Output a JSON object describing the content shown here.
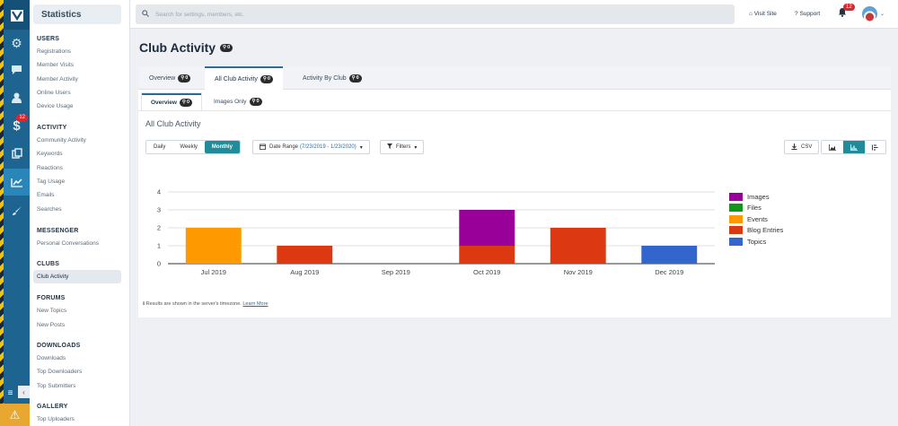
{
  "rail": {
    "notification_badge": "12",
    "icons": [
      "dashboard-icon",
      "chat-icon",
      "user-icon",
      "dollar-icon",
      "clipboard-icon",
      "stats-icon",
      "brush-icon"
    ]
  },
  "sidebar": {
    "title": "Statistics",
    "sections": [
      {
        "heading": "USERS",
        "items": [
          "Registrations",
          "Member Visits",
          "Member Activity",
          "Online Users",
          "Device Usage"
        ]
      },
      {
        "heading": "ACTIVITY",
        "items": [
          "Community Activity",
          "Keywords",
          "Reactions",
          "Tag Usage",
          "Emails",
          "Searches"
        ]
      },
      {
        "heading": "MESSENGER",
        "items": [
          "Personal Conversations"
        ]
      },
      {
        "heading": "CLUBS",
        "items": [
          "Club Activity"
        ]
      },
      {
        "heading": "FORUMS",
        "items": [
          "New Topics",
          "New Posts"
        ]
      },
      {
        "heading": "DOWNLOADS",
        "items": [
          "Downloads",
          "Top Downloaders",
          "Top Submitters"
        ]
      },
      {
        "heading": "GALLERY",
        "items": [
          "Top Uploaders"
        ]
      }
    ]
  },
  "topbar": {
    "search_placeholder": "Search for settings, members, etc.",
    "visit_site": "Visit Site",
    "support": "Support",
    "bell_badge": "12"
  },
  "page": {
    "title": "Club Activity",
    "title_badge": "0",
    "tabs": [
      {
        "label": "Overview",
        "badge": "0"
      },
      {
        "label": "All Club Activity",
        "badge": "0"
      },
      {
        "label": "Activity By Club",
        "badge": "0"
      }
    ],
    "subtabs": [
      {
        "label": "Overview",
        "badge": "0"
      },
      {
        "label": "Images Only",
        "badge": "0"
      }
    ],
    "chart_heading": "All Club Activity",
    "periods": [
      "Daily",
      "Weekly",
      "Monthly"
    ],
    "date_range_label": "Date Range",
    "date_range_value": "(7/23/2019 - 1/23/2020)",
    "filters_label": "Filters",
    "csv_label": "CSV",
    "footnote": "Results are shown in the server's timezone.",
    "learn_more": "Learn More"
  },
  "chart_data": {
    "type": "bar",
    "stacked": true,
    "categories": [
      "Jul 2019",
      "Aug 2019",
      "Sep 2019",
      "Oct 2019",
      "Nov 2019",
      "Dec 2019"
    ],
    "series": [
      {
        "name": "Images",
        "color": "#990099",
        "values": [
          0,
          0,
          0,
          2,
          0,
          0
        ]
      },
      {
        "name": "Files",
        "color": "#109618",
        "values": [
          0,
          0,
          0,
          0,
          0,
          0
        ]
      },
      {
        "name": "Events",
        "color": "#ff9900",
        "values": [
          2,
          0,
          0,
          0,
          0,
          0
        ]
      },
      {
        "name": "Blog Entries",
        "color": "#dc3912",
        "values": [
          0,
          1,
          0,
          1,
          2,
          0
        ]
      },
      {
        "name": "Topics",
        "color": "#3366cc",
        "values": [
          0,
          0,
          0,
          0,
          0,
          1
        ]
      }
    ],
    "ylim": [
      0,
      4
    ],
    "yticks": [
      0,
      1,
      2,
      3,
      4
    ],
    "grid": true,
    "legend": "right"
  }
}
